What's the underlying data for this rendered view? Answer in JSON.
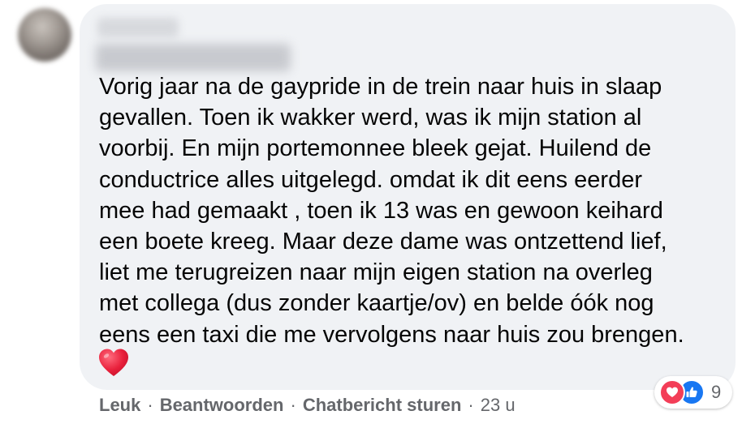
{
  "comment": {
    "text_lines": [
      "Vorig jaar na de gaypride in de trein naar huis in slaap",
      "gevallen. Toen ik wakker werd, was ik mijn station al",
      "voorbij. En mijn portemonnee bleek gejat. Huilend de",
      "conductrice alles uitgelegd. omdat ik dit eens eerder",
      "mee had gemaakt , toen ik 13 was en gewoon keihard",
      "een boete kreeg. Maar deze dame was ontzettend lief,",
      "liet me terugreizen naar mijn eigen station na overleg",
      "met collega (dus zonder kaartje/ov) en belde óók nog",
      "eens een taxi die me vervolgens naar huis zou brengen."
    ],
    "emoji": "heart-emoji"
  },
  "actions": {
    "like_label": "Leuk",
    "reply_label": "Beantwoorden",
    "message_label": "Chatbericht sturen",
    "separator": "·",
    "timestamp": "23 u"
  },
  "reactions": {
    "icons": [
      "love-icon",
      "like-icon"
    ],
    "count": "9",
    "colors": {
      "love": "#f33e58",
      "like": "#1877f2"
    }
  },
  "colors": {
    "bubble_background": "#f0f2f5",
    "text": "#050505",
    "secondary_text": "#65676b"
  }
}
